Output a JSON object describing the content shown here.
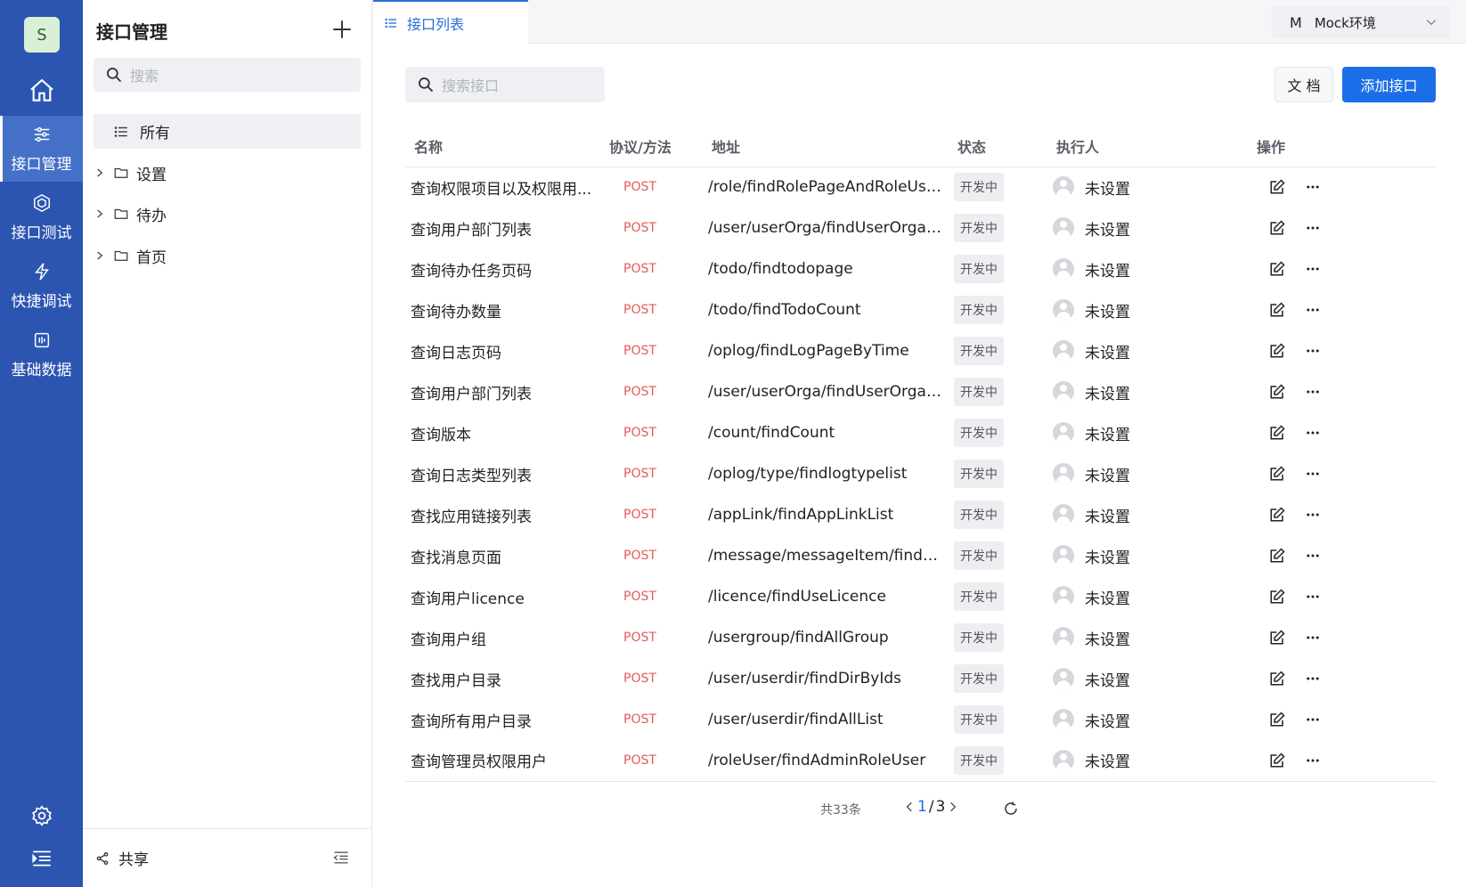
{
  "rail": {
    "avatar": "S",
    "items": [
      {
        "label": "接口管理",
        "icon": "sliders-icon",
        "active": true
      },
      {
        "label": "接口测试",
        "icon": "cube-icon",
        "active": false
      },
      {
        "label": "快捷调试",
        "icon": "lightning-icon",
        "active": false
      },
      {
        "label": "基础数据",
        "icon": "data-icon",
        "active": false
      }
    ]
  },
  "tree": {
    "title": "接口管理",
    "search_placeholder": "搜索",
    "all_label": "所有",
    "folders": [
      "设置",
      "待办",
      "首页"
    ],
    "share_label": "共享"
  },
  "tabs": [
    {
      "label": "接口列表",
      "active": true
    }
  ],
  "env": {
    "badge": "M",
    "label": "Mock环境"
  },
  "main": {
    "search_placeholder": "搜索接口",
    "doc_button": "文 档",
    "add_button": "添加接口",
    "columns": [
      "名称",
      "协议/方法",
      "地址",
      "状态",
      "执行人",
      "操作"
    ],
    "rows": [
      {
        "name": "查询权限项目以及权限用...",
        "method": "POST",
        "path": "/role/findRolePageAndRoleUserN...",
        "status": "开发中",
        "executor": "未设置"
      },
      {
        "name": "查询用户部门列表",
        "method": "POST",
        "path": "/user/userOrga/findUserOrgaPage",
        "status": "开发中",
        "executor": "未设置"
      },
      {
        "name": "查询待办任务页码",
        "method": "POST",
        "path": "/todo/findtodopage",
        "status": "开发中",
        "executor": "未设置"
      },
      {
        "name": "查询待办数量",
        "method": "POST",
        "path": "/todo/findTodoCount",
        "status": "开发中",
        "executor": "未设置"
      },
      {
        "name": "查询日志页码",
        "method": "POST",
        "path": "/oplog/findLogPageByTime",
        "status": "开发中",
        "executor": "未设置"
      },
      {
        "name": "查询用户部门列表",
        "method": "POST",
        "path": "/user/userOrga/findUserOrgaList",
        "status": "开发中",
        "executor": "未设置"
      },
      {
        "name": "查询版本",
        "method": "POST",
        "path": "/count/findCount",
        "status": "开发中",
        "executor": "未设置"
      },
      {
        "name": "查询日志类型列表",
        "method": "POST",
        "path": "/oplog/type/findlogtypelist",
        "status": "开发中",
        "executor": "未设置"
      },
      {
        "name": "查找应用链接列表",
        "method": "POST",
        "path": "/appLink/findAppLinkList",
        "status": "开发中",
        "executor": "未设置"
      },
      {
        "name": "查找消息页面",
        "method": "POST",
        "path": "/message/messageItem/findMess...",
        "status": "开发中",
        "executor": "未设置"
      },
      {
        "name": "查询用户licence",
        "method": "POST",
        "path": "/licence/findUseLicence",
        "status": "开发中",
        "executor": "未设置"
      },
      {
        "name": "查询用户组",
        "method": "POST",
        "path": "/usergroup/findAllGroup",
        "status": "开发中",
        "executor": "未设置"
      },
      {
        "name": "查找用户目录",
        "method": "POST",
        "path": "/user/userdir/findDirByIds",
        "status": "开发中",
        "executor": "未设置"
      },
      {
        "name": "查询所有用户目录",
        "method": "POST",
        "path": "/user/userdir/findAllList",
        "status": "开发中",
        "executor": "未设置"
      },
      {
        "name": "查询管理员权限用户",
        "method": "POST",
        "path": "/roleUser/findAdminRoleUser",
        "status": "开发中",
        "executor": "未设置"
      }
    ]
  },
  "pagination": {
    "total": "共33条",
    "current": "1",
    "separator": "/",
    "pages": "3"
  },
  "colors": {
    "primary": "#1c6ee8",
    "rail": "#2b55b0",
    "method": "#e55a5a"
  }
}
